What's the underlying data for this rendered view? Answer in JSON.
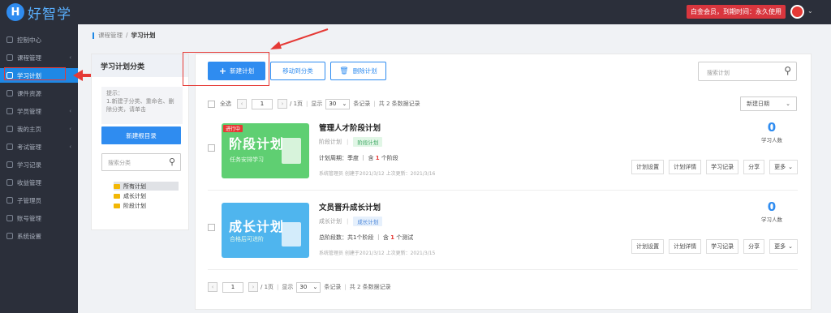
{
  "app": {
    "logo_letter": "H",
    "logo_text": "好智学",
    "member_badge": "白金会员，到期时间：永久使用"
  },
  "sidebar": {
    "items": [
      {
        "label": "控制中心"
      },
      {
        "label": "课程管理"
      },
      {
        "label": "学习计划"
      },
      {
        "label": "课件资源"
      },
      {
        "label": "学员管理"
      },
      {
        "label": "我的主页"
      },
      {
        "label": "考试管理"
      },
      {
        "label": "学习记录"
      },
      {
        "label": "收益管理"
      },
      {
        "label": "子管理员"
      },
      {
        "label": "账号管理"
      },
      {
        "label": "系统设置"
      }
    ]
  },
  "breadcrumb": {
    "parent": "课程管理",
    "separator": "/",
    "current": "学习计划"
  },
  "categories": {
    "title": "学习计划分类",
    "tip": "提示：\n1.新建子分类、重命名、删除分类，请单击",
    "new_root_label": "新建根目录",
    "search_placeholder": "搜索分类",
    "tree": [
      {
        "label": "所有计划"
      },
      {
        "label": "成长计划"
      },
      {
        "label": "阶段计划"
      }
    ]
  },
  "toolbar": {
    "new_plan_label": "新建计划",
    "move_label": "移动到分类",
    "delete_label": "删除计划",
    "search_placeholder": "搜索计划"
  },
  "pager": {
    "select_all": "全选",
    "page": "1",
    "page_total": "/ 1页",
    "show_label": "显示",
    "page_size": "30",
    "records_label": "条记录",
    "total_label": "共 2 条数据记录"
  },
  "sort": {
    "label": "新建日期"
  },
  "plans": [
    {
      "badge": "进行中",
      "cover_title": "阶段计划",
      "cover_subtitle": "任务安排学习",
      "name": "管理人才阶段计划",
      "type": "阶段计划",
      "tag": "阶段计划",
      "period_prefix": "计划周期：季度 ｜ 含",
      "period_count": "1",
      "period_suffix": "个阶段",
      "creator": "系统管理员 创建于2021/3/12 上次更新：2021/3/16",
      "learners": "0",
      "learners_label": "学习人数"
    },
    {
      "badge": "",
      "cover_title": "成长计划",
      "cover_subtitle": "合格后可进阶",
      "name": "文员晋升成长计划",
      "type": "成长计划",
      "tag": "成长计划",
      "period_prefix": "总阶段数：共1个阶段 ｜ 含",
      "period_count": "1",
      "period_suffix": "个测试",
      "creator": "系统管理员 创建于2021/3/12 上次更新：2021/3/15",
      "learners": "0",
      "learners_label": "学习人数"
    }
  ],
  "row_actions": {
    "settings": "计划设置",
    "details": "计划详情",
    "records": "学习记录",
    "share": "分享",
    "more": "更多"
  },
  "colors": {
    "primary": "#2f8cf0",
    "sidebar_bg": "#2b2f3a",
    "annotation_red": "#e53935"
  }
}
